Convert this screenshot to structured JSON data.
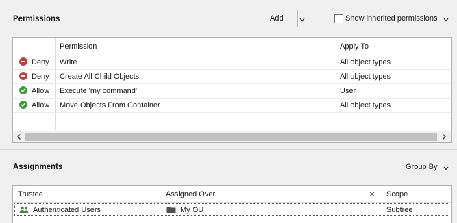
{
  "permissions": {
    "title": "Permissions",
    "add_label": "Add",
    "show_inherited_label": "Show inherited permissions",
    "show_inherited_checked": false,
    "columns": {
      "status": "",
      "permission": "Permission",
      "apply_to": "Apply To"
    },
    "rows": [
      {
        "status": "Deny",
        "status_icon": "deny-icon",
        "permission": "Write",
        "apply_to": "All object types"
      },
      {
        "status": "Deny",
        "status_icon": "deny-icon",
        "permission": "Create All Child Objects",
        "apply_to": "All object types"
      },
      {
        "status": "Allow",
        "status_icon": "allow-icon",
        "permission": "Execute 'my command'",
        "apply_to": "User"
      },
      {
        "status": "Allow",
        "status_icon": "allow-icon",
        "permission": "Move Objects From Container",
        "apply_to": "All object types"
      }
    ]
  },
  "assignments": {
    "title": "Assignments",
    "group_by_label": "Group By",
    "columns": {
      "trustee": "Trustee",
      "assigned_over": "Assigned Over",
      "clear": "✕",
      "scope": "Scope"
    },
    "rows": [
      {
        "trustee": "Authenticated Users",
        "trustee_icon": "users-icon",
        "assigned_over": "My OU",
        "assigned_icon": "folder-icon",
        "scope": "Subtree"
      }
    ]
  },
  "colors": {
    "deny": "#c43d3d",
    "allow": "#3d9a3d",
    "accent": "#6f6f6f"
  }
}
